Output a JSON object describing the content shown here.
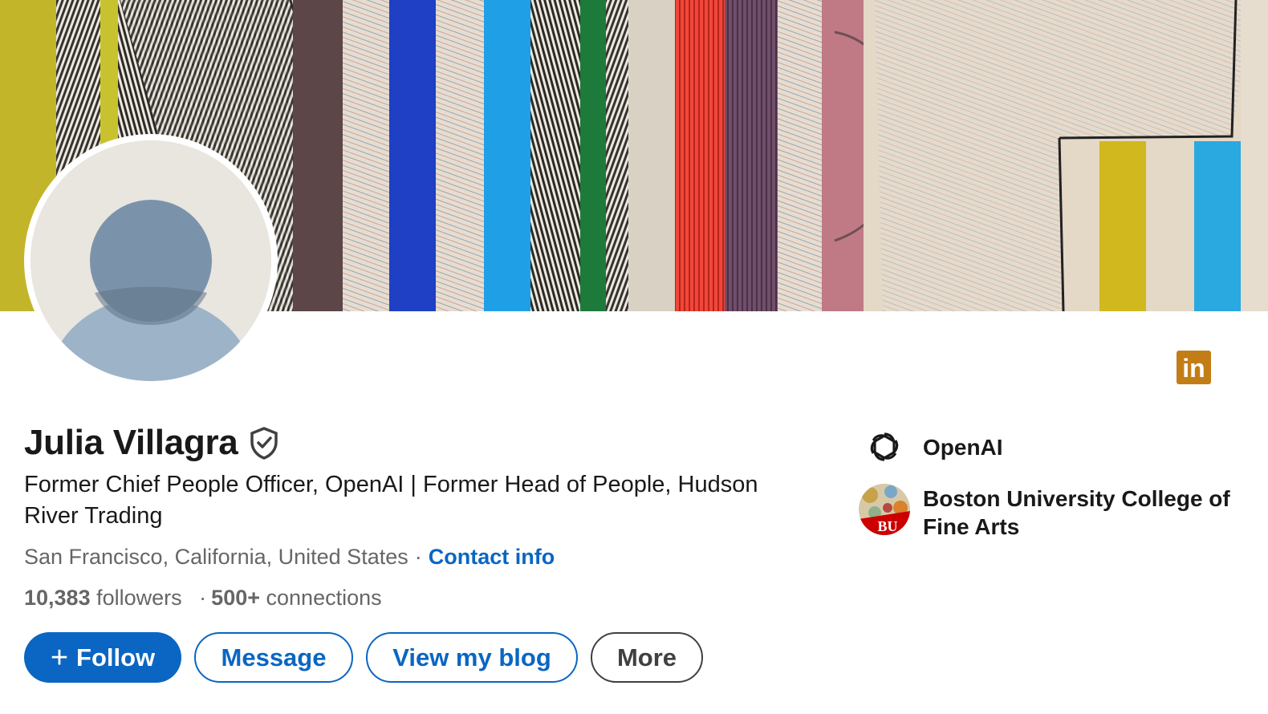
{
  "profile": {
    "name": "Julia Villagra",
    "headline": "Former Chief People Officer, OpenAI | Former Head of People, Hudson River Trading",
    "location": "San Francisco, California, United States",
    "location_separator": "·",
    "contact_label": "Contact info",
    "followers_count": "10,383",
    "followers_label": "followers",
    "stats_separator": "·",
    "connections_count": "500+",
    "connections_label": "connections"
  },
  "actions": {
    "follow_label": "Follow",
    "follow_icon": "plus-icon",
    "message_label": "Message",
    "blog_label": "View my blog",
    "more_label": "More"
  },
  "organizations": [
    {
      "name": "OpenAI",
      "logo": "openai-logo"
    },
    {
      "name": "Boston University College of Fine Arts",
      "logo": "bu-logo",
      "logo_text": "BU"
    }
  ],
  "badge": {
    "icon": "linkedin-premium-icon",
    "text": "in",
    "color": "#c37d16"
  },
  "colors": {
    "primary": "#0a66c2",
    "text": "#191919",
    "muted": "#666666",
    "avatar_bg": "#e9e5df",
    "avatar_figure": "#9db3c8"
  }
}
